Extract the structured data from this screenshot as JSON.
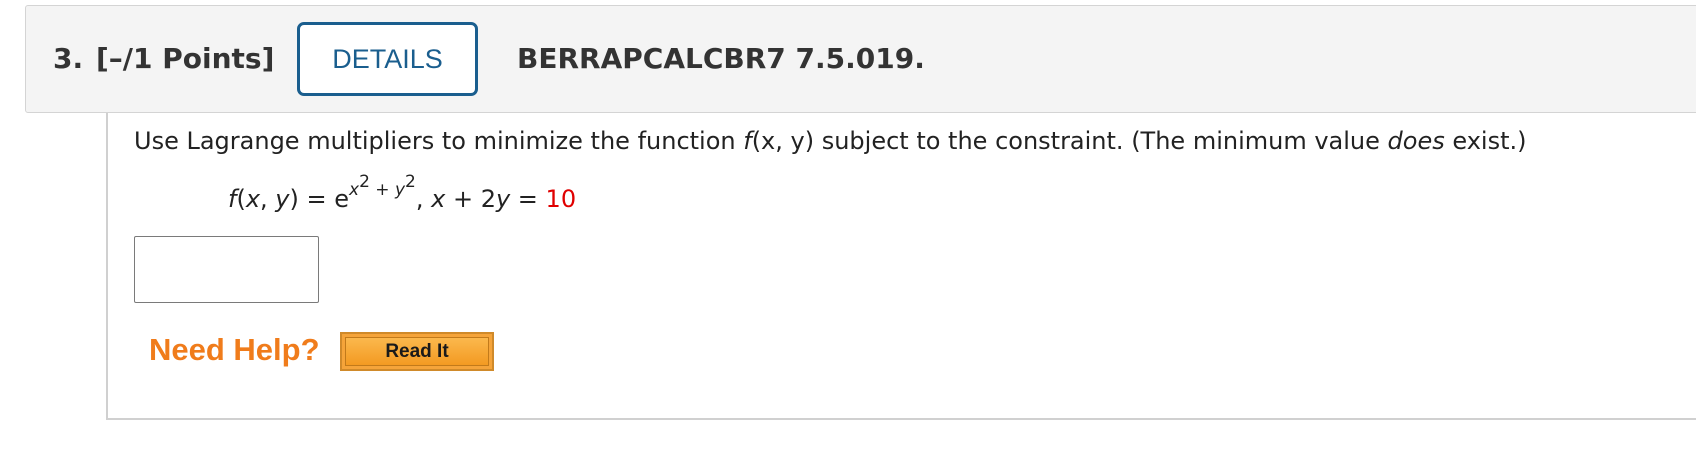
{
  "question": {
    "number": "3.",
    "points": "[–/1 Points]",
    "details_label": "DETAILS",
    "code": "BERRAPCALCBR7 7.5.019."
  },
  "problem": {
    "intro": "Use Lagrange multipliers to minimize the function ",
    "func_name": "f",
    "func_args": "(x, y)",
    "middle": " subject to the constraint. (The minimum value ",
    "emphasis": "does",
    "end": " exist.)"
  },
  "formula": {
    "lhs_name": "f",
    "lhs_open": "(",
    "lhs_x": "x",
    "lhs_comma": ", ",
    "lhs_y": "y",
    "lhs_close": ")",
    "equals": " = e",
    "exp_x": "x",
    "exp_x_pow": "2",
    "exp_plus": " + ",
    "exp_y": "y",
    "exp_y_pow": "2",
    "separator": ",  ",
    "c_x": "x",
    "c_plus": " + 2",
    "c_y": "y",
    "c_equals": " = ",
    "c_value": "10"
  },
  "answer": {
    "value": ""
  },
  "help": {
    "label": "Need Help?",
    "read_it": "Read It"
  },
  "colors": {
    "accent_blue": "#1a5e8e",
    "help_orange": "#f07c1b",
    "button_orange": "#f5a43a",
    "highlight_red": "#e00000"
  }
}
